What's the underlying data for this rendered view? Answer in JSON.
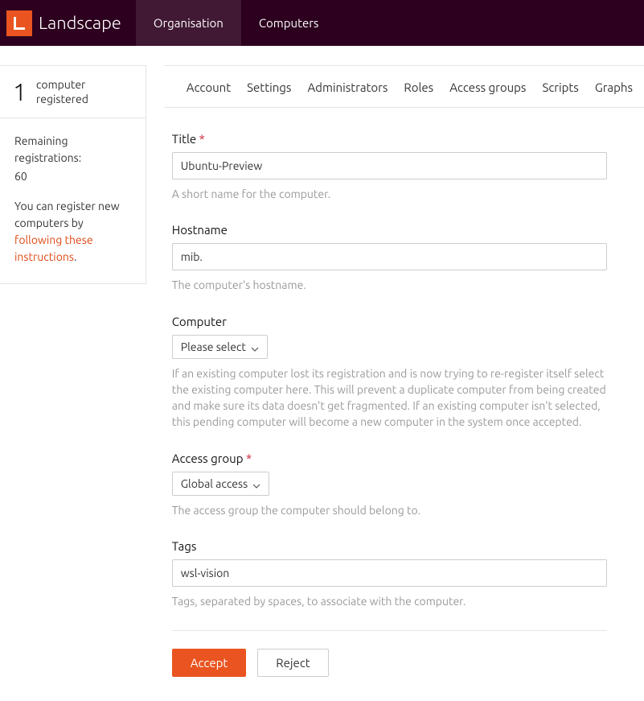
{
  "header": {
    "brand": "Landscape",
    "nav": {
      "organisation": "Organisation",
      "computers": "Computers"
    }
  },
  "sidebar": {
    "count": "1",
    "count_label_line1": "computer",
    "count_label_line2": "registered",
    "remaining_label": "Remaining registrations:",
    "remaining_value": "60",
    "register_text_prefix": "You can register new computers by ",
    "register_link": "following these instructions",
    "register_text_suffix": "."
  },
  "tabs": {
    "account": "Account",
    "settings": "Settings",
    "administrators": "Administrators",
    "roles": "Roles",
    "access_groups": "Access groups",
    "scripts": "Scripts",
    "graphs": "Graphs"
  },
  "form": {
    "title": {
      "label": "Title",
      "value": "Ubuntu-Preview",
      "help": "A short name for the computer."
    },
    "hostname": {
      "label": "Hostname",
      "value": "mib.",
      "help": "The computer's hostname."
    },
    "computer": {
      "label": "Computer",
      "selected": "Please select",
      "help": "If an existing computer lost its registration and is now trying to re-register itself select the existing computer here. This will prevent a duplicate computer from being created and make sure its data doesn't get fragmented. If an existing computer isn't selected, this pending computer will become a new computer in the system once accepted."
    },
    "access_group": {
      "label": "Access group",
      "selected": "Global access",
      "help": "The access group the computer should belong to."
    },
    "tags": {
      "label": "Tags",
      "value": "wsl-vision",
      "help": "Tags, separated by spaces, to associate with the computer."
    },
    "actions": {
      "accept": "Accept",
      "reject": "Reject"
    }
  }
}
